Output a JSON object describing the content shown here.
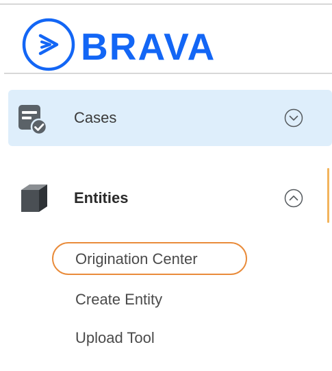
{
  "brand": {
    "name": "BRAVA",
    "icon": "brava-logo-icon",
    "color": "#1366f5"
  },
  "nav": {
    "items": [
      {
        "label": "Cases",
        "icon": "case-check-icon",
        "toggle_icon": "chevron-down-circle-icon",
        "selected": true,
        "expanded": false
      },
      {
        "label": "Entities",
        "icon": "cube-icon",
        "toggle_icon": "chevron-up-circle-icon",
        "selected": false,
        "expanded": true,
        "children": [
          {
            "label": "Origination Center",
            "highlighted": true
          },
          {
            "label": "Create Entity"
          },
          {
            "label": "Upload Tool"
          }
        ]
      }
    ]
  },
  "colors": {
    "selected_bg": "#deeefb",
    "highlight_ring": "#e98b3a",
    "accent": "#f3b45c"
  }
}
